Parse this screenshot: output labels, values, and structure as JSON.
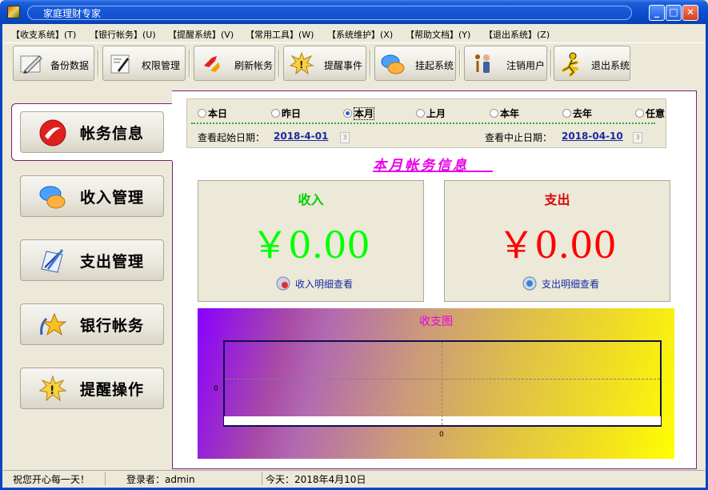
{
  "window": {
    "title": "家庭理财专家"
  },
  "menu": [
    "【收支系统】(T)",
    "【银行帐务】(U)",
    "【提醒系统】(V)",
    "【常用工具】(W)",
    "【系统维护】(X)",
    "【帮助文档】(Y)",
    "【退出系统】(Z)"
  ],
  "toolbar": [
    {
      "label": "备份数据",
      "icon": "pencil-paper-icon"
    },
    {
      "label": "权限管理",
      "icon": "edit-permissions-icon"
    },
    {
      "label": "刷新帐务",
      "icon": "refresh-arrows-icon"
    },
    {
      "label": "提醒事件",
      "icon": "alert-burst-icon"
    },
    {
      "label": "挂起系统",
      "icon": "chat-bubbles-icon"
    },
    {
      "label": "注销用户",
      "icon": "info-user-icon"
    },
    {
      "label": "退出系统",
      "icon": "running-man-icon"
    }
  ],
  "nav": [
    {
      "label": "帐务信息",
      "icon": "red-swirl-icon",
      "selected": true
    },
    {
      "label": "收入管理",
      "icon": "chat-bubbles-icon"
    },
    {
      "label": "支出管理",
      "icon": "design-tools-icon"
    },
    {
      "label": "银行帐务",
      "icon": "star-icon"
    },
    {
      "label": "提醒操作",
      "icon": "alert-burst-icon"
    }
  ],
  "range": {
    "options": [
      "本日",
      "昨日",
      "本月",
      "上月",
      "本年",
      "去年",
      "任意"
    ],
    "selected": "本月",
    "start_label": "查看起始日期：",
    "start_date": "2018-4-01",
    "end_label": "查看中止日期：",
    "end_date": "2018-04-10"
  },
  "section_title": "本月帐务信息",
  "income": {
    "heading": "收入",
    "amount": "￥0.00",
    "link": "收入明细查看",
    "color": "#00ff00"
  },
  "expense": {
    "heading": "支出",
    "amount": "￥0.00",
    "link": "支出明细查看",
    "color": "#ff0000"
  },
  "chart_data": {
    "type": "bar",
    "title": "收支图",
    "categories": [
      ""
    ],
    "values": [
      0
    ],
    "ylim": [
      0,
      0
    ],
    "x_tick_labels": [
      "0"
    ],
    "y_tick_labels": [
      "0"
    ],
    "grid": true
  },
  "status": {
    "greeting": "祝您开心每一天！",
    "login_label": "登录者：",
    "user": "admin",
    "today": "今天：2018年4月10日"
  }
}
